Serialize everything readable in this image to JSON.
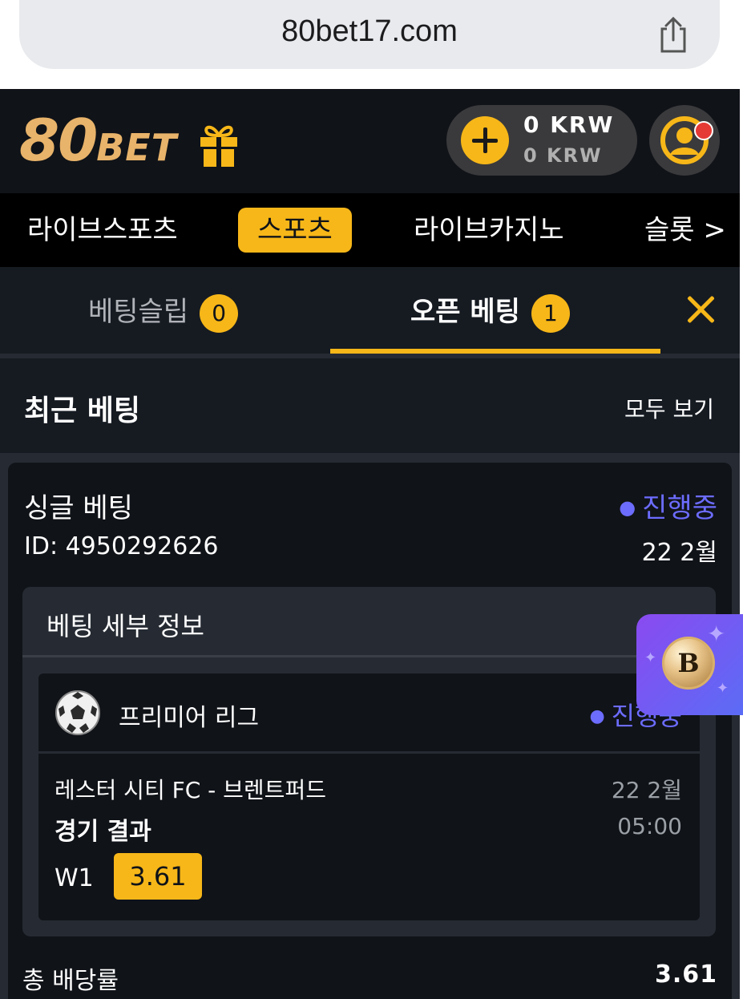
{
  "browser": {
    "url": "80bet17.com"
  },
  "header": {
    "logo_big": "80",
    "logo_small": "BET",
    "balance_main": "0 KRW",
    "balance_sub": "0 KRW"
  },
  "nav": {
    "items": [
      {
        "label": "라이브스포츠"
      },
      {
        "label": "스포츠"
      },
      {
        "label": "라이브카지노"
      },
      {
        "label": "슬롯 >"
      }
    ]
  },
  "tabs": {
    "betslip_label": "베팅슬립",
    "betslip_count": "0",
    "open_label": "오픈 베팅",
    "open_count": "1"
  },
  "recent": {
    "title": "최근 베팅",
    "view_all": "모두 보기"
  },
  "bet": {
    "type": "싱글 베팅",
    "status": "진행중",
    "id": "ID: 4950292626",
    "date": "22 2월",
    "details_title": "베팅 세부 정보",
    "event": {
      "league": "프리미어 리그",
      "status": "진행중",
      "match": "레스터 시티 FC - 브렌트퍼드",
      "date": "22 2월",
      "market": "경기 결과",
      "time": "05:00",
      "pick": "W1",
      "odd": "3.61"
    },
    "total_label": "총 배당률",
    "total_value": "3.61"
  },
  "promo": {
    "coin_letter": "B"
  },
  "colors": {
    "accent": "#f7b718",
    "status": "#6c6cff",
    "bg": "#101318"
  }
}
